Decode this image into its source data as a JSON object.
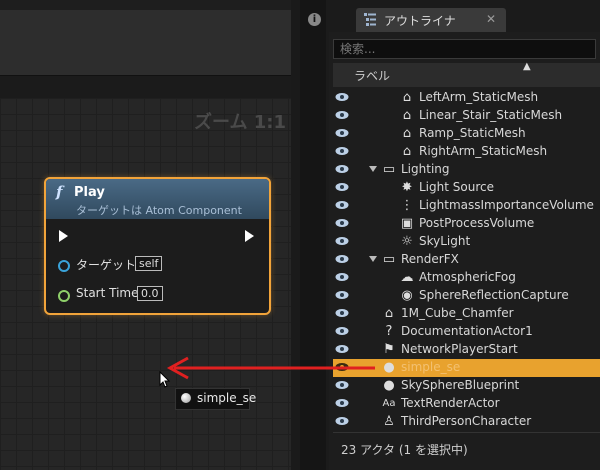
{
  "graph": {
    "zoom_label": "ズーム 1:1",
    "node": {
      "title": "Play",
      "subtitle": "ターゲットは Atom Component",
      "pins": [
        {
          "label": "ターゲット",
          "value": "self"
        },
        {
          "label": "Start Time",
          "value": "0.0"
        }
      ]
    },
    "drag_token": {
      "label": "simple_se"
    }
  },
  "outliner": {
    "tab_title": "アウトライナ",
    "tab_close": "✕",
    "info_label": "i",
    "search_placeholder": "検索...",
    "column_label": "ラベル",
    "rows": [
      {
        "label": "LeftArm_StaticMesh",
        "icon": "static-mesh-icon",
        "indent": 2
      },
      {
        "label": "Linear_Stair_StaticMesh",
        "icon": "static-mesh-icon",
        "indent": 2
      },
      {
        "label": "Ramp_StaticMesh",
        "icon": "static-mesh-icon",
        "indent": 2
      },
      {
        "label": "RightArm_StaticMesh",
        "icon": "static-mesh-icon",
        "indent": 2
      },
      {
        "label": "Lighting",
        "icon": "folder-icon",
        "indent": 1,
        "folder": true
      },
      {
        "label": "Light Source",
        "icon": "directional-light-icon",
        "indent": 2
      },
      {
        "label": "LightmassImportanceVolume",
        "icon": "volume-icon",
        "indent": 2
      },
      {
        "label": "PostProcessVolume",
        "icon": "post-process-icon",
        "indent": 2
      },
      {
        "label": "SkyLight",
        "icon": "skylight-icon",
        "indent": 2
      },
      {
        "label": "RenderFX",
        "icon": "folder-icon",
        "indent": 1,
        "folder": true
      },
      {
        "label": "AtmosphericFog",
        "icon": "fog-icon",
        "indent": 2
      },
      {
        "label": "SphereReflectionCapture",
        "icon": "reflection-capture-icon",
        "indent": 2
      },
      {
        "label": "1M_Cube_Chamfer",
        "icon": "static-mesh-icon",
        "indent": 1
      },
      {
        "label": "DocumentationActor1",
        "icon": "documentation-icon",
        "indent": 1
      },
      {
        "label": "NetworkPlayerStart",
        "icon": "player-start-icon",
        "indent": 1
      },
      {
        "label": "simple_se",
        "icon": "sound-sphere-icon",
        "indent": 1,
        "selected": true
      },
      {
        "label": "SkySphereBlueprint",
        "icon": "sphere-icon",
        "indent": 1
      },
      {
        "label": "TextRenderActor",
        "icon": "text-render-icon",
        "indent": 1
      },
      {
        "label": "ThirdPersonCharacter",
        "icon": "character-icon",
        "indent": 1
      }
    ],
    "status": "23 アクタ (1 を選択中)"
  },
  "colors": {
    "accent": "#e8a22e",
    "node_border": "#f2a43a",
    "arrow": "#e02020"
  }
}
